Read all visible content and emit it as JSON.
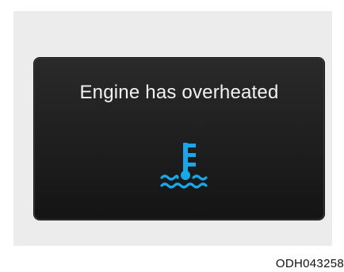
{
  "warning": {
    "message": "Engine has overheated",
    "icon": "coolant-temperature-icon",
    "icon_color": "#1aa7e8"
  },
  "figure_code": "ODH043258",
  "colors": {
    "display_bg": "#1e1e1e",
    "panel_bg": "#ececec",
    "text": "#f2f2f2"
  }
}
